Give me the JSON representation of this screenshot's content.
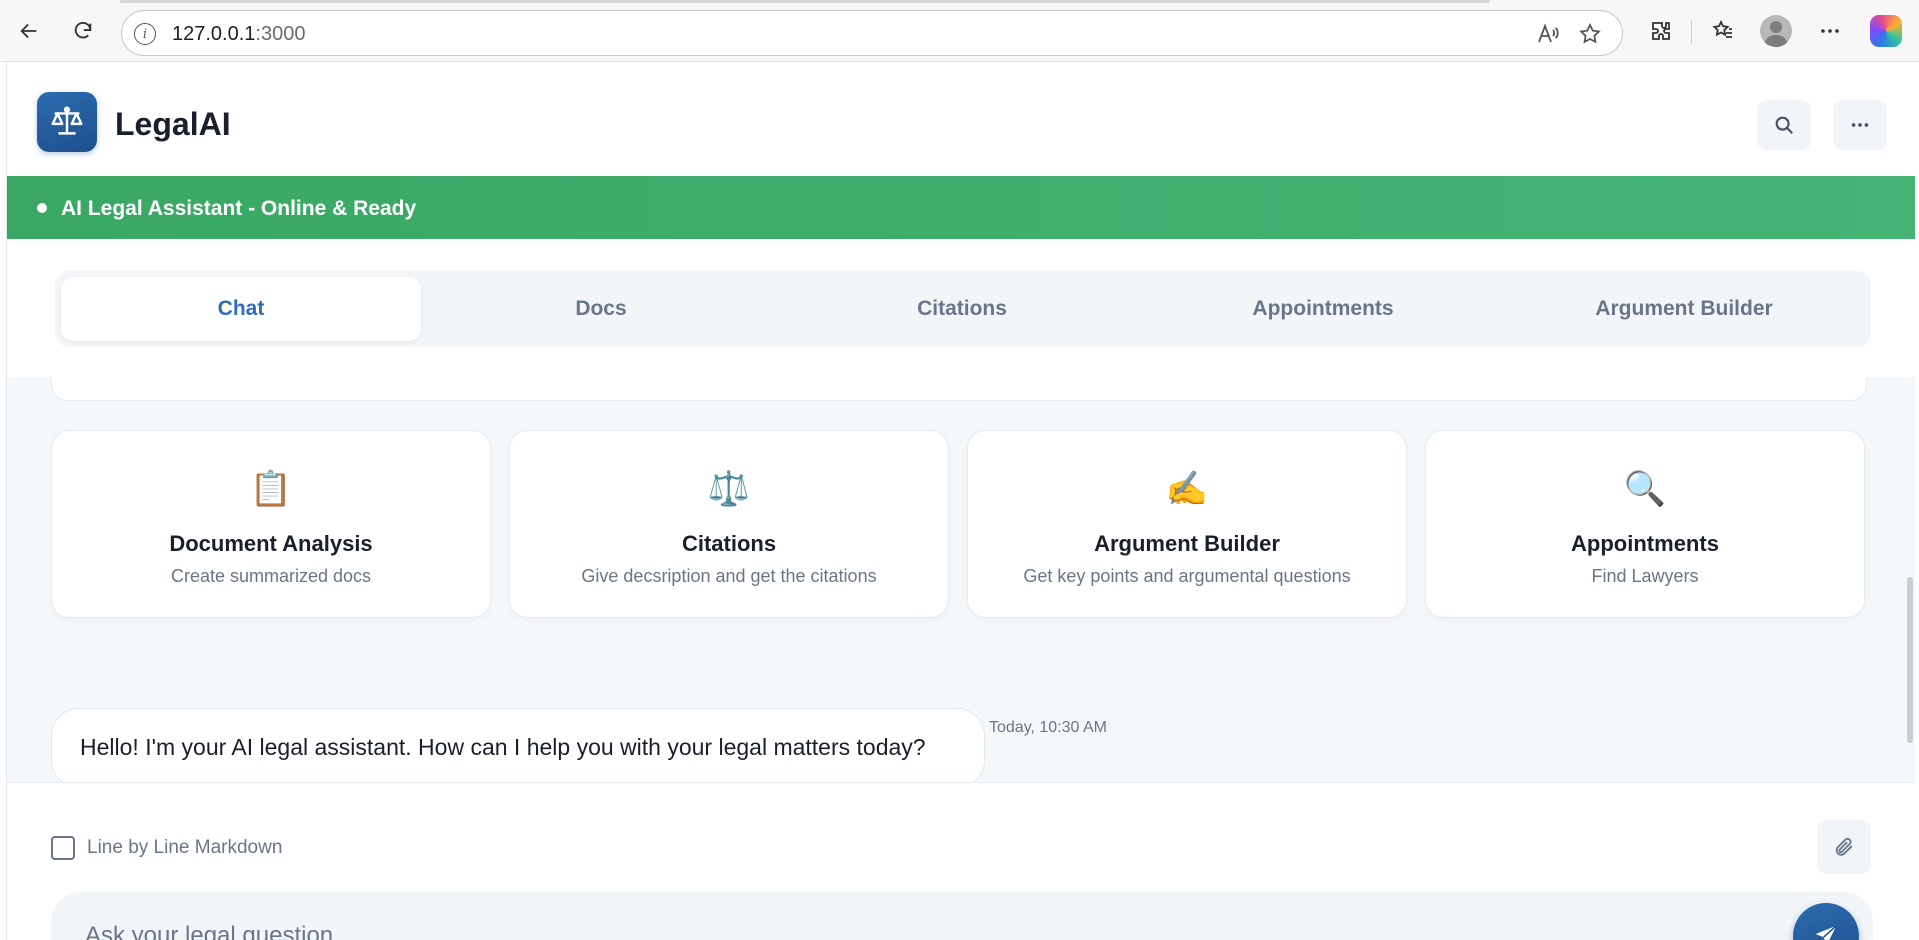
{
  "browser": {
    "url_host": "127.0.0.1",
    "url_port": ":3000"
  },
  "header": {
    "title": "LegalAI",
    "logo_icon": "scales-icon",
    "search_icon": "search-icon",
    "more_icon": "ellipsis-icon"
  },
  "status": {
    "text": "AI Legal Assistant - Online & Ready",
    "color": "#3aa864"
  },
  "tabs": [
    {
      "label": "Chat",
      "active": true
    },
    {
      "label": "Docs",
      "active": false
    },
    {
      "label": "Citations",
      "active": false
    },
    {
      "label": "Appointments",
      "active": false
    },
    {
      "label": "Argument Builder",
      "active": false
    }
  ],
  "features": [
    {
      "icon": "📋",
      "icon_name": "clipboard-icon",
      "title": "Document Analysis",
      "desc": "Create summarized docs"
    },
    {
      "icon": "⚖️",
      "icon_name": "scales-icon",
      "title": "Citations",
      "desc": "Give decsription and get the citations"
    },
    {
      "icon": "✍️",
      "icon_name": "writing-hand-icon",
      "title": "Argument Builder",
      "desc": "Get key points and argumental questions"
    },
    {
      "icon": "🔍",
      "icon_name": "magnifier-icon",
      "title": "Appointments",
      "desc": "Find Lawyers"
    }
  ],
  "message": {
    "text": "Hello! I'm your AI legal assistant. How can I help you with your legal matters today?",
    "time": "Today, 10:30 AM"
  },
  "input": {
    "markdown_label": "Line by Line Markdown",
    "markdown_checked": false,
    "placeholder": "Ask your legal question...",
    "value": ""
  },
  "colors": {
    "accent": "#2d6cbf",
    "brand_dark": "#1d4f8c",
    "status_green": "#3aa864"
  }
}
